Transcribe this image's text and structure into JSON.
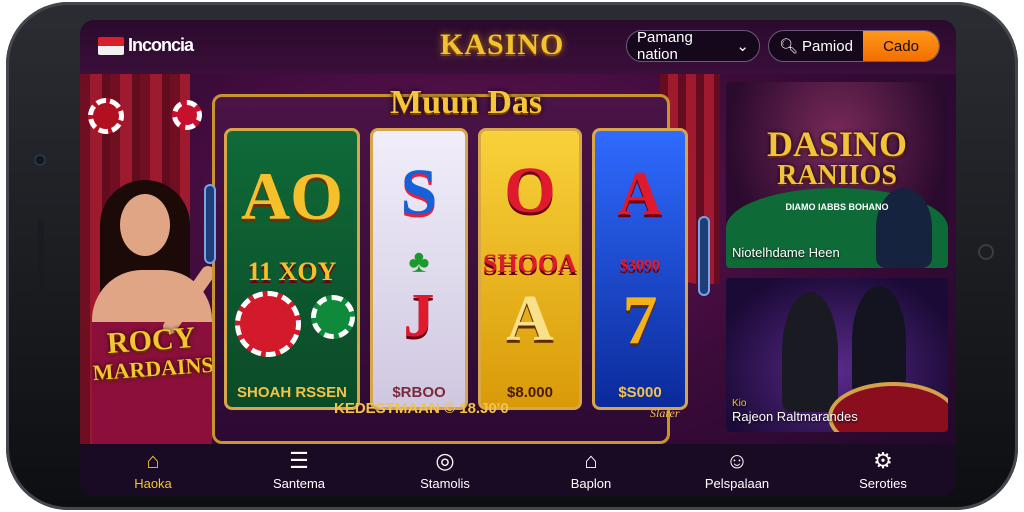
{
  "header": {
    "region_label": "Inconcia",
    "logo_text": "KASINO",
    "pill_label": "Pamang nation",
    "search_label": "Pamiod",
    "cta_label": "Cado"
  },
  "promo": {
    "line1": "ROCY",
    "line2": "MARDAINS"
  },
  "slot": {
    "title": "Muun Das",
    "reels": [
      {
        "top": "AO",
        "middle": "11 XOY",
        "value": "SHOAH  RSSEN"
      },
      {
        "top": "S",
        "middle": "",
        "bottom": "J",
        "value": "$RBOO"
      },
      {
        "top": "O",
        "middle": "SHOOA",
        "bottom": "A",
        "value": "$8.000"
      },
      {
        "top": "A",
        "middle": "$3090",
        "bottom": "7",
        "value": "$S000"
      }
    ],
    "info_text": "KEDESTMAAN © 18.J0'0",
    "spin_label": "Slarer"
  },
  "cards": [
    {
      "title_a": "DASINO",
      "title_b": "RANIIOS",
      "subtitle": "DIAMO IABBS BOHANO",
      "caption": "Niotelhdame Heen"
    },
    {
      "badge": "Kio",
      "caption": "Rajeon Raltmarandes"
    }
  ],
  "nav": [
    {
      "label": "Haoka",
      "icon": "home-icon",
      "active": true
    },
    {
      "label": "Santema",
      "icon": "menu-icon",
      "active": false
    },
    {
      "label": "Stamolis",
      "icon": "location-icon",
      "active": false
    },
    {
      "label": "Baplon",
      "icon": "house-icon",
      "active": false
    },
    {
      "label": "Pelspalaan",
      "icon": "users-icon",
      "active": false
    },
    {
      "label": "Seroties",
      "icon": "settings-icon",
      "active": false
    }
  ],
  "colors": {
    "accent": "#f4c23a",
    "cta": "#f36c00",
    "bg": "#3c0b3a"
  }
}
